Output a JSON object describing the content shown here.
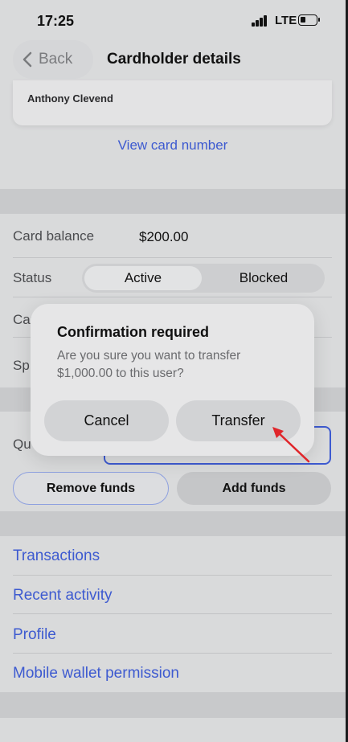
{
  "status_bar": {
    "time": "17:25",
    "network": "LTE"
  },
  "header": {
    "back_label": "Back",
    "title": "Cardholder details"
  },
  "card": {
    "holder_name": "Anthony Clevend",
    "view_card_number_label": "View card number"
  },
  "details": {
    "balance_label": "Card balance",
    "balance_value": "$200.00",
    "status_label": "Status",
    "status_options": [
      "Active",
      "Blocked"
    ],
    "status_selected": "Active",
    "row3_label_partial": "Car",
    "row4_label_partial": "Sp"
  },
  "funds": {
    "quantity_label_partial": "Qu",
    "remove_label": "Remove funds",
    "add_label": "Add funds"
  },
  "links": [
    "Transactions",
    "Recent activity",
    "Profile",
    "Mobile wallet permission"
  ],
  "dialog": {
    "title": "Confirmation required",
    "message": "Are you sure you want to transfer $1,000.00 to this user?",
    "cancel_label": "Cancel",
    "confirm_label": "Transfer"
  },
  "colors": {
    "accent": "#3d5ad0",
    "annotation_arrow": "#e0262b"
  }
}
